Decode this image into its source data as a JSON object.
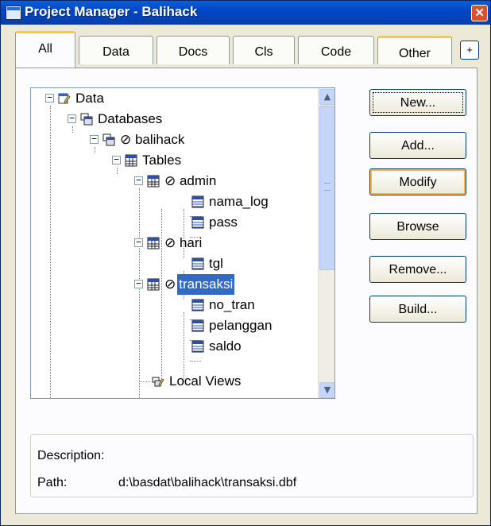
{
  "window": {
    "title": "Project Manager - Balihack",
    "close_glyph": "✕"
  },
  "tabs": [
    {
      "label": "All",
      "active": true
    },
    {
      "label": "Data"
    },
    {
      "label": "Docs"
    },
    {
      "label": "Cls"
    },
    {
      "label": "Code"
    },
    {
      "label": "Other",
      "hot": true
    }
  ],
  "tab_scroll_glyph": "+",
  "tree": {
    "nodes": [
      {
        "id": "data",
        "label": "Data",
        "icon": "data-icon"
      },
      {
        "id": "databases",
        "label": "Databases",
        "icon": "databases-icon"
      },
      {
        "id": "balihack",
        "label": "⊘ balihack",
        "icon": "database-icon"
      },
      {
        "id": "tables",
        "label": "Tables",
        "icon": "tables-icon"
      },
      {
        "id": "admin",
        "label": "⊘ admin",
        "icon": "table-icon"
      },
      {
        "id": "nama_log",
        "label": "nama_log",
        "icon": "field-icon"
      },
      {
        "id": "pass",
        "label": "pass",
        "icon": "field-icon"
      },
      {
        "id": "hari",
        "label": "⊘ hari",
        "icon": "table-icon"
      },
      {
        "id": "tgl",
        "label": "tgl",
        "icon": "field-icon"
      },
      {
        "id": "transaksi_prefix",
        "label": "⊘"
      },
      {
        "id": "transaksi",
        "label": "transaksi",
        "icon": "table-icon",
        "selected": true
      },
      {
        "id": "no_tran",
        "label": "no_tran",
        "icon": "field-icon"
      },
      {
        "id": "pelanggan",
        "label": "pelanggan",
        "icon": "field-icon"
      },
      {
        "id": "saldo",
        "label": "saldo",
        "icon": "field-icon"
      },
      {
        "id": "local_views",
        "label": "Local Views",
        "icon": "local-views-icon"
      }
    ],
    "expand_glyph_open": "−"
  },
  "buttons": {
    "new": "New...",
    "add": "Add...",
    "modify": "Modify",
    "browse": "Browse",
    "remove": "Remove...",
    "build": "Build..."
  },
  "description": {
    "label": "Description:",
    "path_label": "Path:",
    "path_value": "d:\\basdat\\balihack\\transaksi.dbf"
  },
  "colors": {
    "selection": "#316ac5",
    "titlebar": "#0046c8",
    "tab_hot": "#ffc83c"
  }
}
